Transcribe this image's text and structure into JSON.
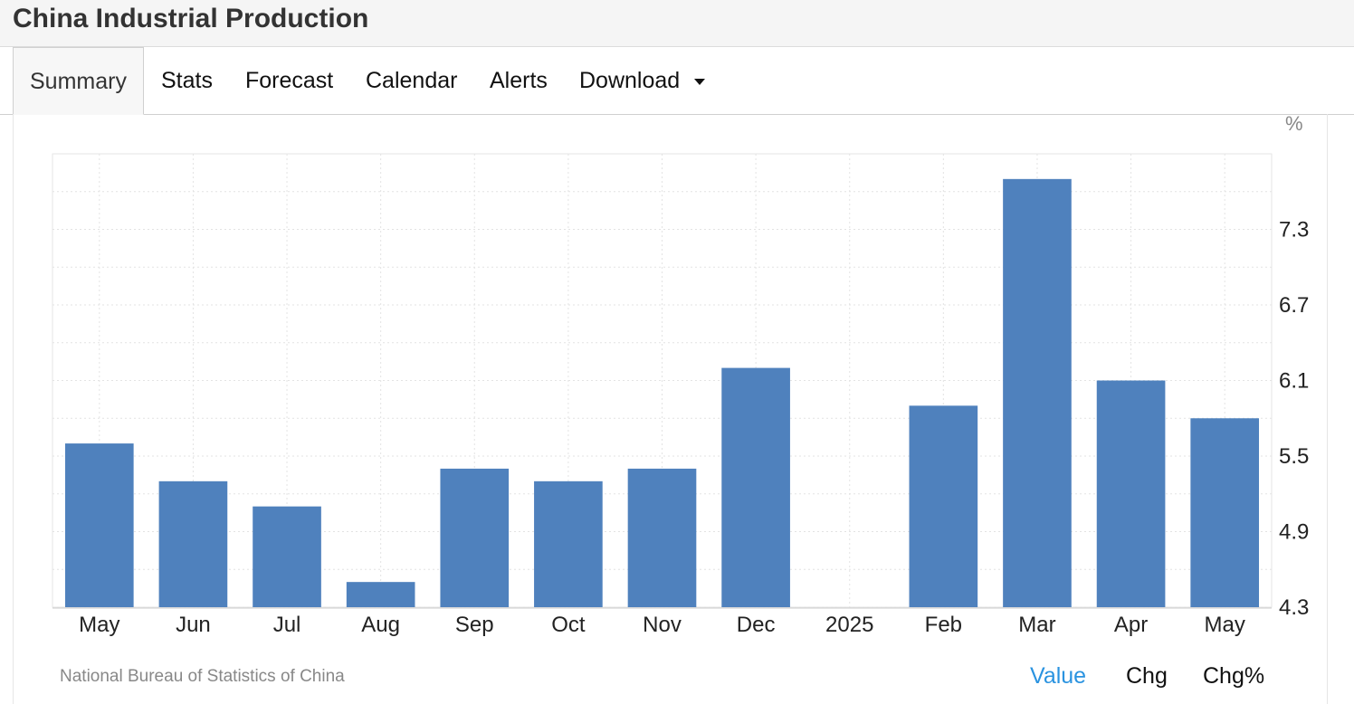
{
  "page_title": "China Industrial Production",
  "tabs": [
    {
      "label": "Summary",
      "active": true
    },
    {
      "label": "Stats"
    },
    {
      "label": "Forecast"
    },
    {
      "label": "Calendar"
    },
    {
      "label": "Alerts"
    },
    {
      "label": "Download",
      "dropdown": true
    }
  ],
  "unit_label": "%",
  "source": "National Bureau of Statistics of China",
  "modes": [
    {
      "label": "Value",
      "active": true
    },
    {
      "label": "Chg"
    },
    {
      "label": "Chg%"
    }
  ],
  "colors": {
    "bar": "#4f81bd",
    "active_mode": "#2a93e0",
    "grid": "#e3e3e3"
  },
  "chart_data": {
    "type": "bar",
    "categories": [
      "May",
      "Jun",
      "Jul",
      "Aug",
      "Sep",
      "Oct",
      "Nov",
      "Dec",
      "2025",
      "Feb",
      "Mar",
      "Apr",
      "May"
    ],
    "values": [
      5.6,
      5.3,
      5.1,
      4.5,
      5.4,
      5.3,
      5.4,
      6.2,
      null,
      5.9,
      7.7,
      6.1,
      5.8
    ],
    "yticks": [
      4.3,
      4.9,
      5.5,
      6.1,
      6.7,
      7.3
    ],
    "ylim": [
      4.3,
      7.9
    ],
    "grid": true
  }
}
